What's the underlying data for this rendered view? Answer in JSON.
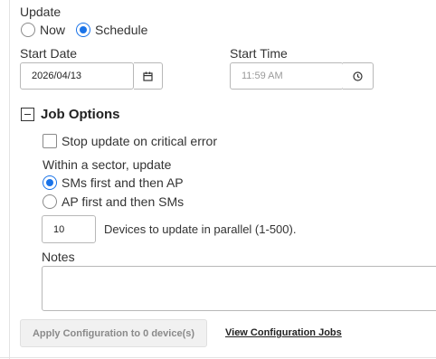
{
  "update": {
    "label": "Update",
    "options": [
      {
        "label": "Now",
        "selected": false
      },
      {
        "label": "Schedule",
        "selected": true
      }
    ]
  },
  "start_date": {
    "label": "Start Date",
    "value": "2026/04/13",
    "icon": "calendar-icon"
  },
  "start_time": {
    "label": "Start Time",
    "value": "11:59 AM",
    "icon": "clock-icon"
  },
  "job_options": {
    "title": "Job Options",
    "stop_on_error": {
      "label": "Stop update on critical error",
      "checked": false
    },
    "sector_label": "Within a sector, update",
    "sector_options": [
      {
        "label": "SMs first and then AP",
        "selected": true
      },
      {
        "label": "AP first and then SMs",
        "selected": false
      }
    ],
    "parallel": {
      "value": "10",
      "label": "Devices to update in parallel (1-500)."
    },
    "notes_label": "Notes"
  },
  "actions": {
    "apply_label": "Apply Configuration to 0 device(s)",
    "view_jobs_label": "View Configuration Jobs"
  },
  "colors": {
    "accent": "#1a73e8"
  }
}
